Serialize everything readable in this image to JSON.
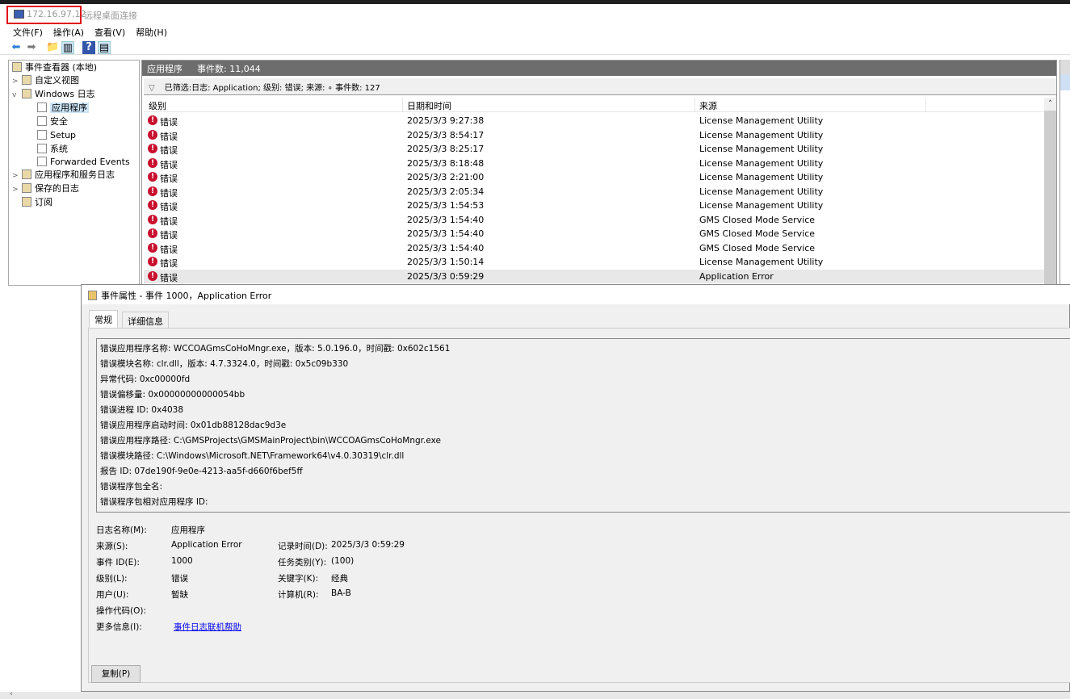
{
  "window": {
    "host": "172.16.97.12",
    "app": "远程桌面连接"
  },
  "menu": [
    "文件(F)",
    "操作(A)",
    "查看(V)",
    "帮助(H)"
  ],
  "tree": {
    "root": "事件查看器 (本地)",
    "items": [
      {
        "label": "自定义视图",
        "level": 1,
        "expander": ">"
      },
      {
        "label": "Windows 日志",
        "level": 1,
        "expander": "v"
      },
      {
        "label": "应用程序",
        "level": 2,
        "selected": true
      },
      {
        "label": "安全",
        "level": 2
      },
      {
        "label": "Setup",
        "level": 2
      },
      {
        "label": "系统",
        "level": 2
      },
      {
        "label": "Forwarded Events",
        "level": 2
      },
      {
        "label": "应用程序和服务日志",
        "level": 1,
        "expander": ">"
      },
      {
        "label": "保存的日志",
        "level": 1,
        "expander": ">"
      },
      {
        "label": "订阅",
        "level": 1
      }
    ]
  },
  "center": {
    "title": "应用程序",
    "count": "事件数: 11,044",
    "filter": "已筛选:日志: Application; 级别: 错误; 来源: ∘ 事件数: 127",
    "columns": [
      "级别",
      "日期和时间",
      "来源"
    ],
    "rows": [
      [
        "错误",
        "2025/3/3 9:27:38",
        "License Management Utility"
      ],
      [
        "错误",
        "2025/3/3 8:54:17",
        "License Management Utility"
      ],
      [
        "错误",
        "2025/3/3 8:25:17",
        "License Management Utility"
      ],
      [
        "错误",
        "2025/3/3 8:18:48",
        "License Management Utility"
      ],
      [
        "错误",
        "2025/3/3 2:21:00",
        "License Management Utility"
      ],
      [
        "错误",
        "2025/3/3 2:05:34",
        "License Management Utility"
      ],
      [
        "错误",
        "2025/3/3 1:54:53",
        "License Management Utility"
      ],
      [
        "错误",
        "2025/3/3 1:54:40",
        "GMS Closed Mode Service"
      ],
      [
        "错误",
        "2025/3/3 1:54:40",
        "GMS Closed Mode Service"
      ],
      [
        "错误",
        "2025/3/3 1:54:40",
        "GMS Closed Mode Service"
      ],
      [
        "错误",
        "2025/3/3 1:50:14",
        "License Management Utility"
      ],
      [
        "错误",
        "2025/3/3 0:59:29",
        "Application Error"
      ]
    ]
  },
  "dialog": {
    "title": "事件属性 - 事件 1000，Application Error",
    "tabs": [
      "常规",
      "详细信息"
    ],
    "description": [
      "错误应用程序名称: WCCOAGmsCoHoMngr.exe，版本: 5.0.196.0，时间戳: 0x602c1561",
      "错误模块名称: clr.dll，版本: 4.7.3324.0，时间戳: 0x5c09b330",
      "异常代码: 0xc00000fd",
      "错误偏移量: 0x00000000000054bb",
      "错误进程 ID: 0x4038",
      "错误应用程序启动时间: 0x01db88128dac9d3e",
      "错误应用程序路径: C:\\GMSProjects\\GMSMainProject\\bin\\WCCOAGmsCoHoMngr.exe",
      "错误模块路径: C:\\Windows\\Microsoft.NET\\Framework64\\v4.0.30319\\clr.dll",
      "报告 ID: 07de190f-9e0e-4213-aa5f-d660f6bef5ff",
      "错误程序包全名:",
      "错误程序包相对应用程序 ID:"
    ],
    "props": {
      "log_name_label": "日志名称(M):",
      "log_name": "应用程序",
      "source_label": "来源(S):",
      "source": "Application Error",
      "logged_label": "记录时间(D):",
      "logged": "2025/3/3 0:59:29",
      "event_id_label": "事件 ID(E):",
      "event_id": "1000",
      "task_label": "任务类别(Y):",
      "task": "(100)",
      "level_label": "级别(L):",
      "level": "错误",
      "keywords_label": "关键字(K):",
      "keywords": "经典",
      "user_label": "用户(U):",
      "user": "暂缺",
      "computer_label": "计算机(R):",
      "computer": "BA-B",
      "opcode_label": "操作代码(O):",
      "moreinfo_label": "更多信息(I):",
      "moreinfo_link": "事件日志联机帮助"
    },
    "copy_button": "复制(P)"
  }
}
